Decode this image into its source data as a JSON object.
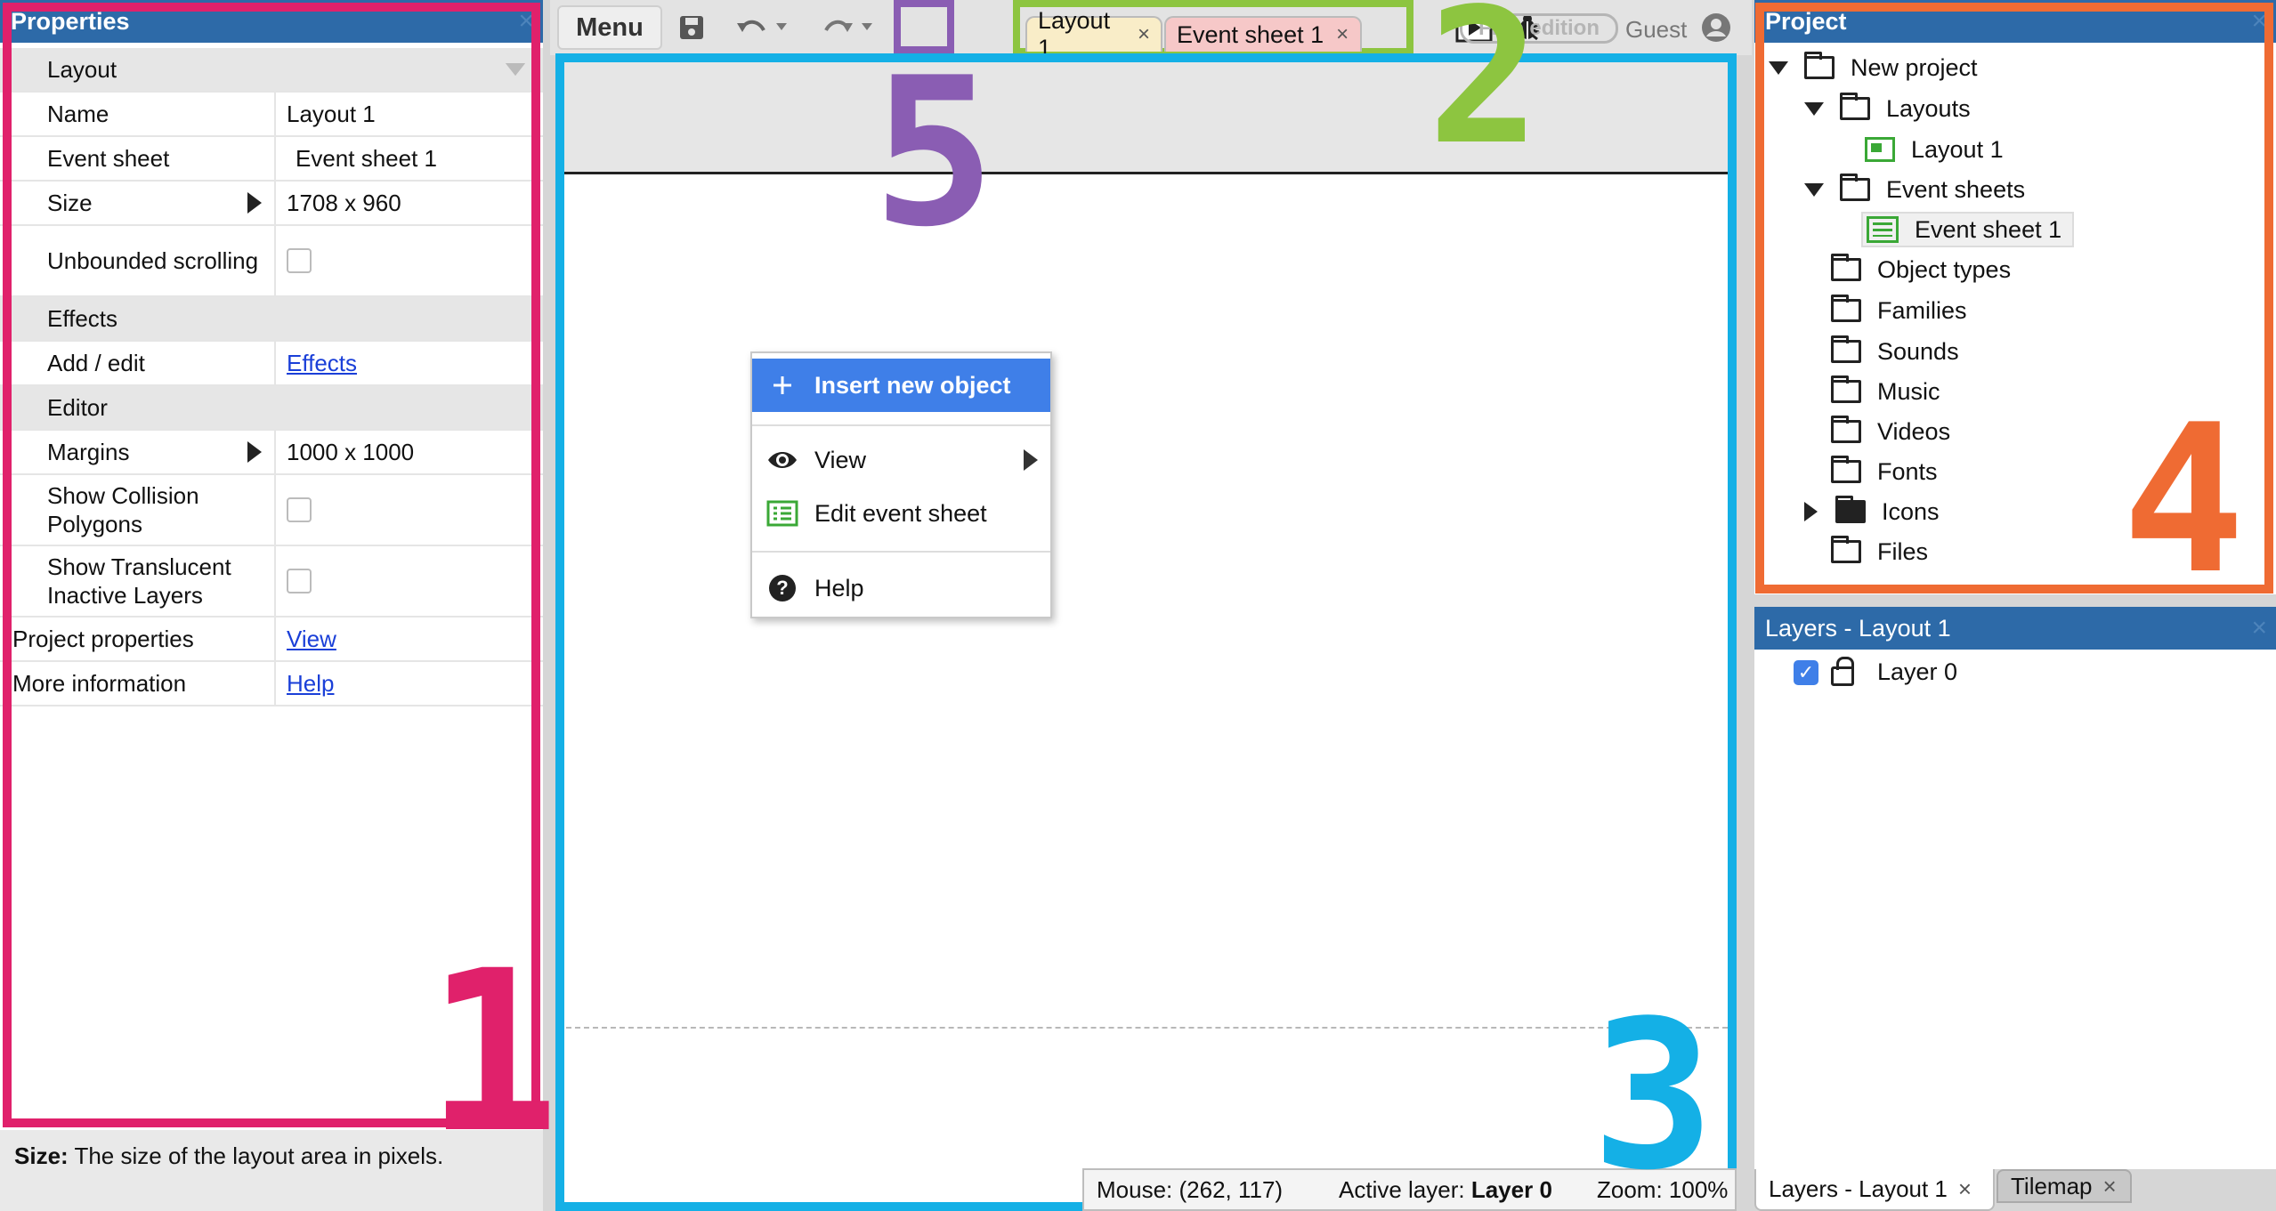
{
  "properties": {
    "title": "Properties",
    "close": "×",
    "sections": {
      "layout": "Layout",
      "effects": "Effects",
      "editor": "Editor"
    },
    "rows": {
      "name_label": "Name",
      "name_value": "Layout 1",
      "event_sheet_label": "Event sheet",
      "event_sheet_value": "Event sheet 1",
      "size_label": "Size",
      "size_value": "1708 x 960",
      "unbounded_label": "Unbounded scrolling",
      "add_edit_label": "Add / edit",
      "add_edit_link": "Effects",
      "margins_label": "Margins",
      "margins_value": "1000 x 1000",
      "collision_label": "Show Collision Polygons",
      "translucent_label": "Show Translucent Inactive Layers",
      "project_props_label": "Project properties",
      "project_props_link": "View",
      "more_info_label": "More information",
      "more_info_link": "Help"
    },
    "help": {
      "term": "Size:",
      "text": "The size of the layout area in pixels."
    }
  },
  "toolbar": {
    "menu_label": "Menu",
    "tabs": [
      {
        "label": "Layout 1",
        "close": "×"
      },
      {
        "label": "Event sheet 1",
        "close": "×"
      }
    ],
    "badge": "Free edition",
    "user": "Guest"
  },
  "context_menu": {
    "insert": "Insert new object",
    "view": "View",
    "edit_sheet": "Edit event sheet",
    "help": "Help"
  },
  "status_bar": {
    "mouse": "Mouse: (262, 117)",
    "active_layer_label": "Active layer:",
    "active_layer_value": "Layer 0",
    "zoom": "Zoom: 100%"
  },
  "project": {
    "title": "Project",
    "close": "×",
    "root": "New project",
    "layouts": "Layouts",
    "layout_1": "Layout 1",
    "event_sheets": "Event sheets",
    "event_sheet_1": "Event sheet 1",
    "object_types": "Object types",
    "families": "Families",
    "sounds": "Sounds",
    "music": "Music",
    "videos": "Videos",
    "fonts": "Fonts",
    "icons": "Icons",
    "files": "Files"
  },
  "layers": {
    "title": "Layers - Layout 1",
    "close": "×",
    "layer_0": "Layer 0",
    "check": "✓"
  },
  "bottom_tabs": [
    {
      "label": "Layers - Layout 1",
      "close": "×"
    },
    {
      "label": "Tilemap",
      "close": "×"
    }
  ],
  "annotations": [
    "1",
    "2",
    "3",
    "4",
    "5"
  ],
  "colors": {
    "annotation_1": "#e0216b",
    "annotation_2": "#8dc540",
    "annotation_3": "#14b0e6",
    "annotation_4": "#ef6b33",
    "annotation_5": "#8a5db3",
    "panel_header": "#2d6aa8",
    "menu_highlight": "#3f7fe8"
  }
}
